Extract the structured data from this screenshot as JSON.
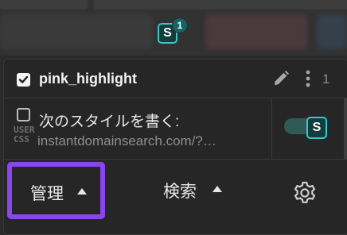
{
  "toolbar": {
    "extension_icon": "stylus-s-icon",
    "extension_logo_letter": "S",
    "extension_badge": "1"
  },
  "popup": {
    "styles": [
      {
        "name": "pink_highlight",
        "enabled": true,
        "count": "1"
      }
    ],
    "write_new": {
      "title": "次のスタイルを書く:",
      "url": "instantdomainsearch.com/?…",
      "usercss_mark": "USER CSS",
      "logo_letter": "S"
    },
    "footer": {
      "manage_label": "管理",
      "search_label": "検索",
      "settings_icon": "gear-icon"
    }
  },
  "colors": {
    "highlight_border": "#8b45f0",
    "accent": "#39c7c5",
    "panel_bg": "#262626"
  }
}
